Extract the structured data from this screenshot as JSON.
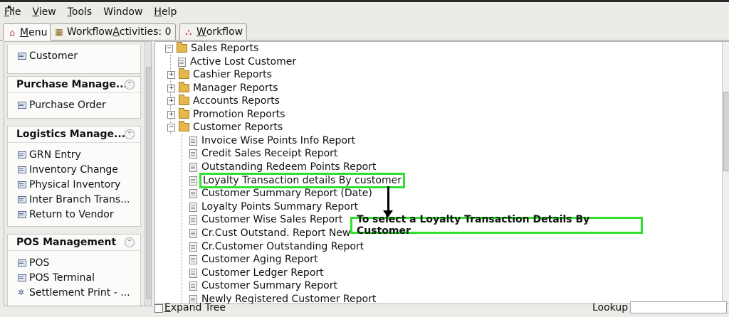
{
  "menubar": {
    "items": [
      {
        "pre": "",
        "key": "F",
        "rest": "ile"
      },
      {
        "pre": "",
        "key": "V",
        "rest": "iew"
      },
      {
        "pre": "",
        "key": "T",
        "rest": "ools"
      },
      {
        "pre": "",
        "key": "",
        "rest": "Window"
      },
      {
        "pre": "",
        "key": "H",
        "rest": "elp"
      }
    ]
  },
  "tabs": [
    {
      "pre": "",
      "key": "M",
      "rest": "enu"
    },
    {
      "pre": "Workflow ",
      "key": "A",
      "rest": "ctivities: 0"
    },
    {
      "pre": "",
      "key": "W",
      "rest": "orkflow"
    }
  ],
  "left": {
    "top_item": "Customer",
    "groups": [
      {
        "title": "Purchase Manage...",
        "items": [
          "Purchase Order"
        ]
      },
      {
        "title": "Logistics Manage...",
        "items": [
          "GRN Entry",
          "Inventory Change",
          "Physical Inventory",
          "Inter Branch Trans...",
          "Return to Vendor"
        ]
      },
      {
        "title": "POS Management",
        "items": [
          "POS",
          "POS Terminal",
          "Settlement Print - ..."
        ]
      }
    ]
  },
  "tree": {
    "root": "Sales Reports",
    "root_children": [
      "Active Lost Customer",
      "Cashier Reports",
      "Manager Reports",
      "Accounts Reports",
      "Promotion Reports",
      "Customer Reports"
    ],
    "customer_reports": [
      "Invoice Wise Points Info Report",
      "Credit Sales Receipt Report",
      "Outstanding Redeem Points Report",
      "Loyalty Transaction details By customer",
      "Customer Summary Report (Date)",
      "Loyalty Points Summary Report",
      "Customer Wise Sales Report",
      "Cr.Cust Outstand. Report New",
      "Cr.Customer Outstanding Report",
      "Customer Aging Report",
      "Customer Ledger Report",
      "Customer Summary Report",
      "Newly Registered Customer Report"
    ]
  },
  "callout": "To select a Loyalty Transaction Details By Customer",
  "bottom": {
    "expand_pre": "",
    "expand_key": "E",
    "expand_rest": "xpand Tree",
    "lookup": "Lookup",
    "lookup_value": ""
  },
  "colors": {
    "highlight": "#2fe02f",
    "folder": "#e6b84a"
  }
}
